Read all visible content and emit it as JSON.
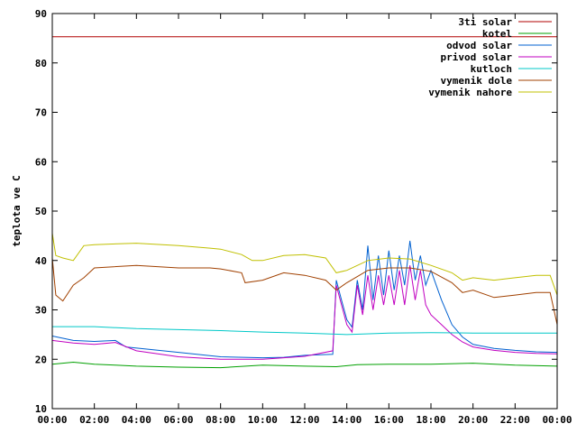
{
  "chart_data": {
    "type": "line",
    "title": "",
    "xlabel": "",
    "ylabel": "teplota ve C",
    "ylim": [
      10,
      90
    ],
    "yticks": [
      "10",
      "20",
      "30",
      "40",
      "50",
      "60",
      "70",
      "80",
      "90"
    ],
    "xlim": [
      "00:00",
      "24:00"
    ],
    "xticks": [
      "00:00",
      "02:00",
      "04:00",
      "06:00",
      "08:00",
      "10:00",
      "12:00",
      "14:00",
      "16:00",
      "18:00",
      "20:00",
      "22:00",
      "00:00"
    ],
    "grid": false,
    "legend": "top-right",
    "series": [
      {
        "name": "3ti solar",
        "color": "#b00000",
        "x": [
          "00:00",
          "24:00"
        ],
        "y": [
          85.3,
          85.3
        ]
      },
      {
        "name": "kotel",
        "color": "#00a000",
        "x": [
          "00:00",
          "01:00",
          "02:00",
          "03:00",
          "04:00",
          "06:00",
          "08:00",
          "10:00",
          "12:00",
          "13:30",
          "14:30",
          "16:00",
          "18:00",
          "20:00",
          "22:00",
          "24:00"
        ],
        "y": [
          19.0,
          19.4,
          19.0,
          18.8,
          18.6,
          18.4,
          18.3,
          18.8,
          18.6,
          18.5,
          18.9,
          19.0,
          19.0,
          19.2,
          18.8,
          18.6
        ]
      },
      {
        "name": "odvod solar",
        "color": "#0060d0",
        "x": [
          "00:00",
          "01:00",
          "02:00",
          "03:00",
          "03:30",
          "06:00",
          "08:00",
          "10:00",
          "11:00",
          "12:00",
          "13:20",
          "13:30",
          "13:45",
          "14:00",
          "14:15",
          "14:30",
          "14:45",
          "15:00",
          "15:15",
          "15:30",
          "15:45",
          "16:00",
          "16:15",
          "16:30",
          "16:45",
          "17:00",
          "17:15",
          "17:30",
          "17:45",
          "18:00",
          "18:30",
          "19:00",
          "19:30",
          "20:00",
          "21:00",
          "22:00",
          "23:00",
          "24:00"
        ],
        "y": [
          24.7,
          23.8,
          23.6,
          23.8,
          22.5,
          21.4,
          20.5,
          20.3,
          20.4,
          20.8,
          21.0,
          36.0,
          32.0,
          28.0,
          26.5,
          36.0,
          30.0,
          43.0,
          32.0,
          41.0,
          33.0,
          42.0,
          34.0,
          41.0,
          35.0,
          44.0,
          36.0,
          41.0,
          35.0,
          38.0,
          32.0,
          27.0,
          24.5,
          23.0,
          22.2,
          21.8,
          21.5,
          21.4
        ]
      },
      {
        "name": "privod solar",
        "color": "#c000c0",
        "x": [
          "00:00",
          "01:00",
          "02:00",
          "03:00",
          "04:00",
          "06:00",
          "08:00",
          "10:00",
          "11:00",
          "12:00",
          "13:20",
          "13:30",
          "13:45",
          "14:00",
          "14:15",
          "14:30",
          "14:45",
          "15:00",
          "15:15",
          "15:30",
          "15:45",
          "16:00",
          "16:15",
          "16:30",
          "16:45",
          "17:00",
          "17:15",
          "17:30",
          "17:45",
          "18:00",
          "18:30",
          "19:00",
          "19:30",
          "20:00",
          "21:00",
          "22:00",
          "23:00",
          "24:00"
        ],
        "y": [
          23.8,
          23.3,
          23.0,
          23.4,
          21.7,
          20.5,
          20.0,
          20.0,
          20.3,
          20.6,
          21.7,
          35.0,
          31.0,
          27.0,
          25.5,
          35.0,
          29.0,
          37.0,
          30.0,
          37.0,
          31.0,
          37.0,
          31.0,
          38.0,
          31.0,
          39.0,
          32.0,
          38.0,
          31.0,
          29.0,
          27.0,
          25.0,
          23.5,
          22.5,
          21.8,
          21.4,
          21.2,
          21.1
        ]
      },
      {
        "name": "kutloch",
        "color": "#00c8c8",
        "x": [
          "00:00",
          "02:00",
          "04:00",
          "06:00",
          "08:00",
          "10:00",
          "12:00",
          "14:00",
          "16:00",
          "18:00",
          "20:00",
          "22:00",
          "24:00"
        ],
        "y": [
          26.6,
          26.6,
          26.2,
          26.0,
          25.8,
          25.5,
          25.3,
          25.0,
          25.3,
          25.4,
          25.3,
          25.3,
          25.3
        ]
      },
      {
        "name": "vymenik dole",
        "color": "#a04000",
        "x": [
          "00:00",
          "00:10",
          "00:30",
          "01:00",
          "01:30",
          "02:00",
          "04:00",
          "06:00",
          "07:30",
          "08:00",
          "09:00",
          "09:10",
          "10:00",
          "11:00",
          "12:00",
          "13:00",
          "13:30",
          "14:00",
          "15:00",
          "16:00",
          "17:00",
          "18:00",
          "19:00",
          "19:30",
          "20:00",
          "21:00",
          "22:00",
          "23:00",
          "23:40",
          "24:00"
        ],
        "y": [
          40.5,
          33.0,
          31.8,
          35.0,
          36.5,
          38.5,
          39.0,
          38.5,
          38.5,
          38.3,
          37.5,
          35.5,
          36.0,
          37.5,
          37.0,
          36.0,
          34.0,
          35.5,
          38.0,
          38.5,
          38.5,
          37.8,
          35.5,
          33.5,
          34.0,
          32.5,
          33.0,
          33.5,
          33.5,
          27.0
        ]
      },
      {
        "name": "vymenik nahore",
        "color": "#c0c000",
        "x": [
          "00:00",
          "00:10",
          "00:30",
          "01:00",
          "01:30",
          "02:00",
          "04:00",
          "06:00",
          "07:30",
          "08:00",
          "09:00",
          "09:30",
          "10:00",
          "11:00",
          "12:00",
          "13:00",
          "13:30",
          "14:00",
          "15:00",
          "16:00",
          "17:00",
          "18:00",
          "19:00",
          "19:30",
          "20:00",
          "21:00",
          "22:00",
          "23:00",
          "23:40",
          "24:00"
        ],
        "y": [
          45.5,
          41.0,
          40.5,
          40.0,
          43.0,
          43.2,
          43.5,
          43.0,
          42.5,
          42.3,
          41.2,
          40.0,
          40.0,
          41.0,
          41.2,
          40.5,
          37.5,
          38.0,
          40.0,
          40.5,
          40.3,
          39.0,
          37.5,
          36.0,
          36.5,
          36.0,
          36.5,
          37.0,
          37.0,
          33.0
        ]
      }
    ]
  }
}
